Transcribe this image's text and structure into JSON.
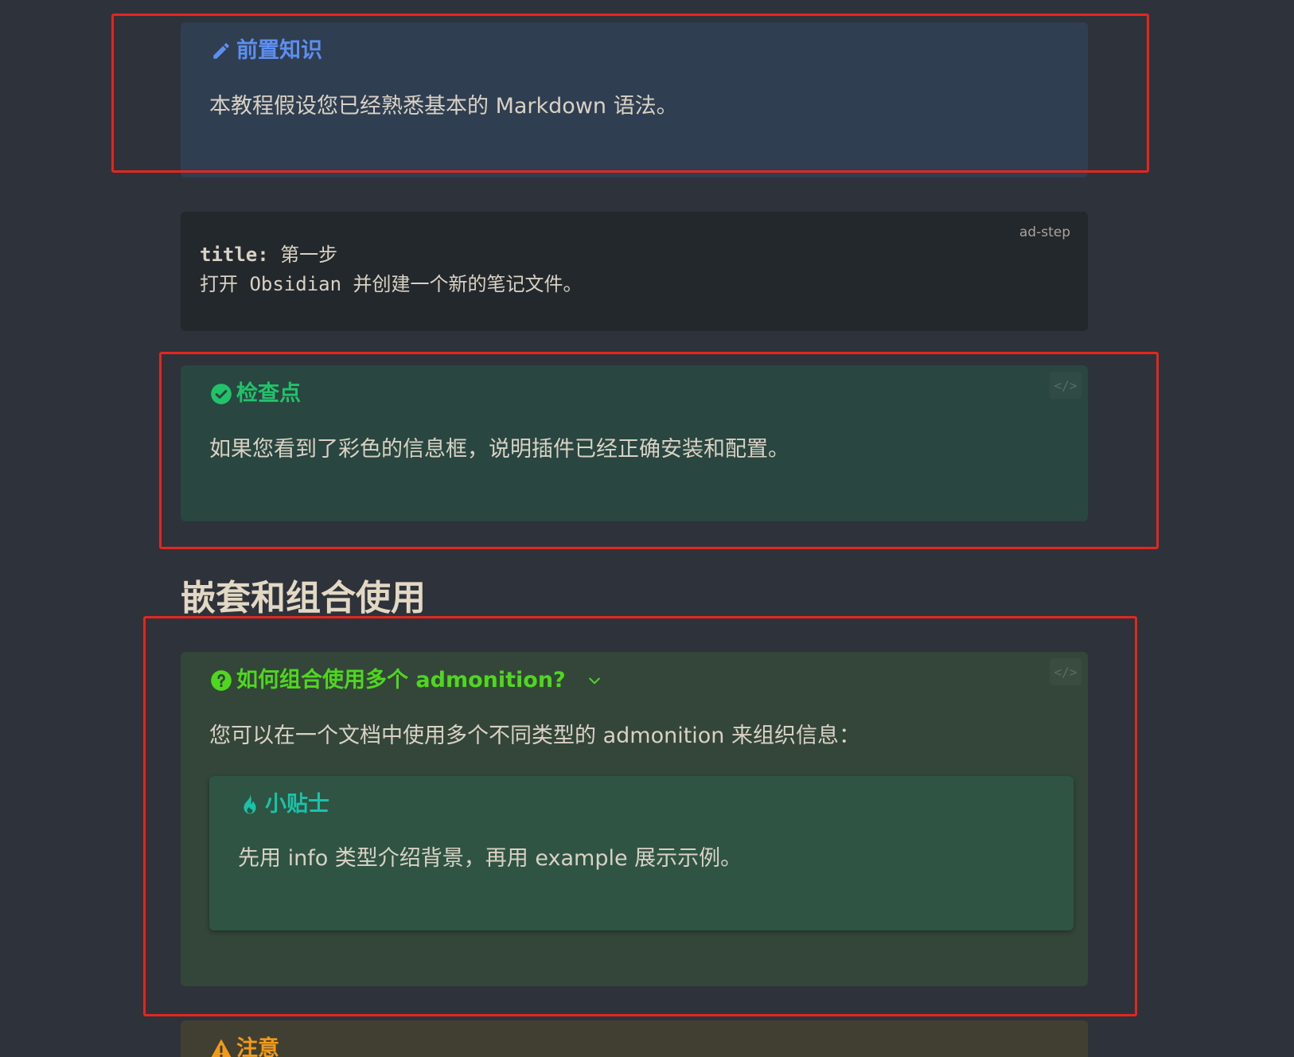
{
  "prereq": {
    "title": "前置知识",
    "icon": "pencil-icon",
    "body": "本教程假设您已经熟悉基本的 Markdown 语法。",
    "color": "#5b8ff0"
  },
  "code_block": {
    "language": "ad-step",
    "line1_key": "title:",
    "line1_value": " 第一步",
    "line2": "打开 Obsidian 并创建一个新的笔记文件。"
  },
  "checkpoint": {
    "title": "检查点",
    "icon": "check-circle-icon",
    "body": "如果您看到了彩色的信息框，说明插件已经正确安装和配置。",
    "color": "#22c26a"
  },
  "section_heading": "嵌套和组合使用",
  "question": {
    "title": "如何组合使用多个 admonition?",
    "icon": "question-circle-icon",
    "body": "您可以在一个文档中使用多个不同类型的 admonition 来组织信息：",
    "color": "#4fd61f"
  },
  "tip": {
    "title": "小贴士",
    "icon": "flame-icon",
    "body": "先用 info 类型介绍背景，再用 example 展示示例。",
    "color": "#19c2a8"
  },
  "warning": {
    "title": "注意",
    "icon": "warning-triangle-icon",
    "color": "#f09a18"
  },
  "code_toggle_label": "</>",
  "annotation_color": "#e3271f"
}
